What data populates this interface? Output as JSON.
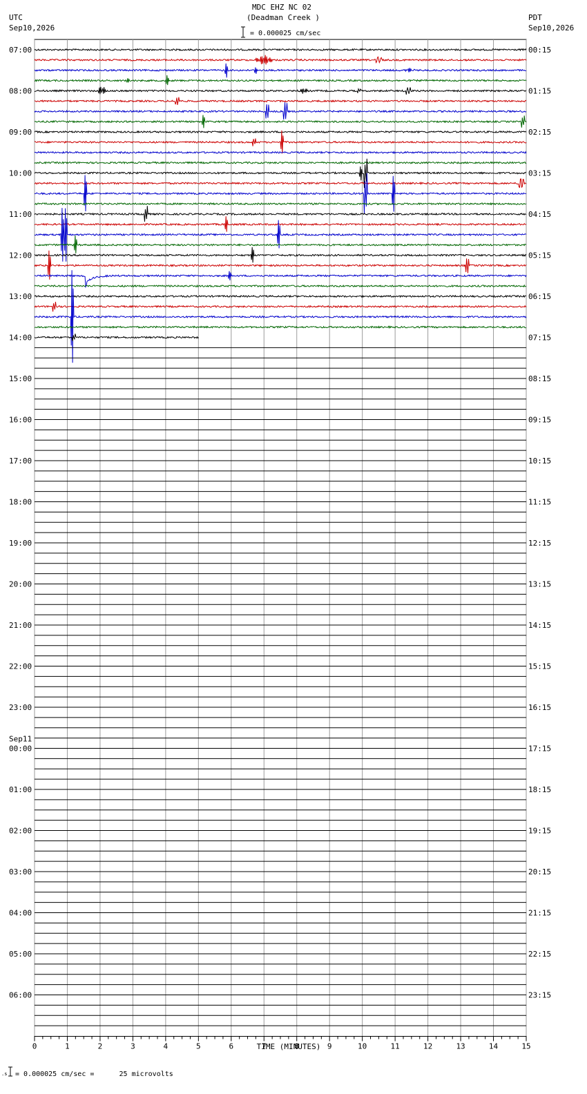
{
  "header": {
    "title": "MDC EHZ NC 02",
    "subtitle": "(Deadman Creek )",
    "scale": "= 0.000025 cm/sec",
    "left_tz": "UTC",
    "left_date": "Sep10,2026",
    "right_tz": "PDT",
    "right_date": "Sep10,2026"
  },
  "footer": {
    "scale_note": "= 0.000025 cm/sec =      25 microvolts"
  },
  "chart_data": {
    "type": "line",
    "title": "MDC EHZ NC 02",
    "subtitle": "(Deadman Creek )",
    "xlabel": "TIME (MINUTES)",
    "xlim": [
      0,
      15
    ],
    "x_ticks": [
      "0",
      "1",
      "2",
      "3",
      "4",
      "5",
      "6",
      "7",
      "8",
      "9",
      "10",
      "11",
      "12",
      "13",
      "14",
      "15"
    ],
    "traces_per_hour": 4,
    "trace_colors": [
      "#000000",
      "#cc0000",
      "#0000cc",
      "#006600"
    ],
    "left_labels": [
      "07:00",
      "08:00",
      "09:00",
      "10:00",
      "11:00",
      "12:00",
      "13:00",
      "14:00",
      "15:00",
      "16:00",
      "17:00",
      "18:00",
      "19:00",
      "20:00",
      "21:00",
      "22:00",
      "23:00",
      "00:00",
      "01:00",
      "02:00",
      "03:00",
      "04:00",
      "05:00",
      "06:00"
    ],
    "left_date_change": {
      "index": 17,
      "label": "Sep11"
    },
    "right_labels": [
      "00:15",
      "01:15",
      "02:15",
      "03:15",
      "04:15",
      "05:15",
      "06:15",
      "07:15",
      "08:15",
      "09:15",
      "10:15",
      "11:15",
      "12:15",
      "13:15",
      "14:15",
      "15:15",
      "16:15",
      "17:15",
      "18:15",
      "19:15",
      "20:15",
      "21:15",
      "22:15",
      "23:15"
    ],
    "recorded_traces": 29,
    "last_trace_end_minute": 5.0,
    "events": [
      {
        "trace": 1,
        "minute": 7.0,
        "amp": 8,
        "width": 0.35,
        "burst": true
      },
      {
        "trace": 1,
        "minute": 10.5,
        "amp": 4,
        "width": 0.1
      },
      {
        "trace": 2,
        "minute": 5.85,
        "amp": 10,
        "width": 0.05
      },
      {
        "trace": 2,
        "minute": 6.75,
        "amp": 5,
        "width": 0.05
      },
      {
        "trace": 2,
        "minute": 11.4,
        "amp": 3,
        "width": 0.2,
        "burst": true
      },
      {
        "trace": 3,
        "minute": 4.05,
        "amp": 8,
        "width": 0.05
      },
      {
        "trace": 3,
        "minute": 2.85,
        "amp": 4,
        "width": 0.05
      },
      {
        "trace": 4,
        "minute": 2.05,
        "amp": 9,
        "width": 0.15,
        "burst": true
      },
      {
        "trace": 4,
        "minute": 8.2,
        "amp": 4,
        "width": 0.2,
        "burst": true
      },
      {
        "trace": 4,
        "minute": 9.9,
        "amp": 3,
        "width": 0.05
      },
      {
        "trace": 4,
        "minute": 11.4,
        "amp": 5,
        "width": 0.08
      },
      {
        "trace": 5,
        "minute": 4.35,
        "amp": 6,
        "width": 0.06
      },
      {
        "trace": 6,
        "minute": 7.1,
        "amp": 12,
        "width": 0.06
      },
      {
        "trace": 6,
        "minute": 7.65,
        "amp": 14,
        "width": 0.06
      },
      {
        "trace": 7,
        "minute": 5.15,
        "amp": 9,
        "width": 0.05
      },
      {
        "trace": 7,
        "minute": 14.9,
        "amp": 8,
        "width": 0.05
      },
      {
        "trace": 9,
        "minute": 6.7,
        "amp": 6,
        "width": 0.05
      },
      {
        "trace": 9,
        "minute": 7.55,
        "amp": 18,
        "width": 0.05
      },
      {
        "trace": 12,
        "minute": 9.95,
        "amp": 10,
        "width": 0.05
      },
      {
        "trace": 12,
        "minute": 10.1,
        "amp": 22,
        "width": 0.05
      },
      {
        "trace": 13,
        "minute": 14.85,
        "amp": 8,
        "width": 0.08
      },
      {
        "trace": 14,
        "minute": 1.55,
        "amp": 28,
        "width": 0.05
      },
      {
        "trace": 14,
        "minute": 10.1,
        "amp": 30,
        "width": 0.05
      },
      {
        "trace": 14,
        "minute": 10.95,
        "amp": 28,
        "width": 0.05
      },
      {
        "trace": 16,
        "minute": 3.4,
        "amp": 12,
        "width": 0.05
      },
      {
        "trace": 17,
        "minute": 5.85,
        "amp": 12,
        "width": 0.05
      },
      {
        "trace": 18,
        "minute": 7.45,
        "amp": 22,
        "width": 0.05
      },
      {
        "trace": 18,
        "minute": 0.85,
        "amp": 40,
        "width": 0.05
      },
      {
        "trace": 18,
        "minute": 0.95,
        "amp": 40,
        "width": 0.05
      },
      {
        "trace": 19,
        "minute": 1.25,
        "amp": 14,
        "width": 0.05
      },
      {
        "trace": 20,
        "minute": 6.65,
        "amp": 12,
        "width": 0.05
      },
      {
        "trace": 21,
        "minute": 0.45,
        "amp": 22,
        "width": 0.05
      },
      {
        "trace": 21,
        "minute": 13.2,
        "amp": 12,
        "width": 0.06
      },
      {
        "trace": 22,
        "minute": 1.55,
        "amp": 18,
        "width": 0.3,
        "decay": true
      },
      {
        "trace": 22,
        "minute": 5.95,
        "amp": 6,
        "width": 0.05
      },
      {
        "trace": 25,
        "minute": 0.6,
        "amp": 8,
        "width": 0.05
      },
      {
        "trace": 26,
        "minute": 1.15,
        "amp": 70,
        "width": 0.05
      },
      {
        "trace": 28,
        "minute": 1.2,
        "amp": 6,
        "width": 0.05
      }
    ]
  }
}
